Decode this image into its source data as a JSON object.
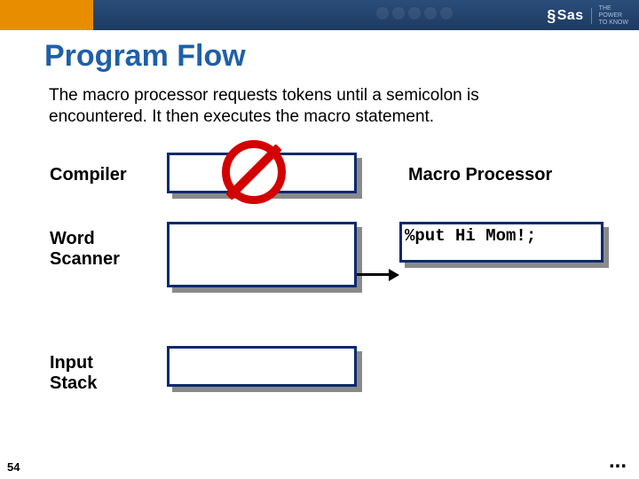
{
  "header": {
    "logo_text": "Sas",
    "logo_tag_line1": "THE",
    "logo_tag_line2": "POWER",
    "logo_tag_line3": "TO KNOW"
  },
  "title": "Program Flow",
  "description": "The macro processor requests tokens until a semicolon is encountered. It then executes the macro statement.",
  "labels": {
    "compiler": "Compiler",
    "word_scanner_l1": "Word",
    "word_scanner_l2": "Scanner",
    "input_stack_l1": "Input",
    "input_stack_l2": "Stack",
    "macro_processor": "Macro Processor"
  },
  "macro_box_code": "%put Hi Mom!;",
  "page_number": "54",
  "continuation": "..."
}
